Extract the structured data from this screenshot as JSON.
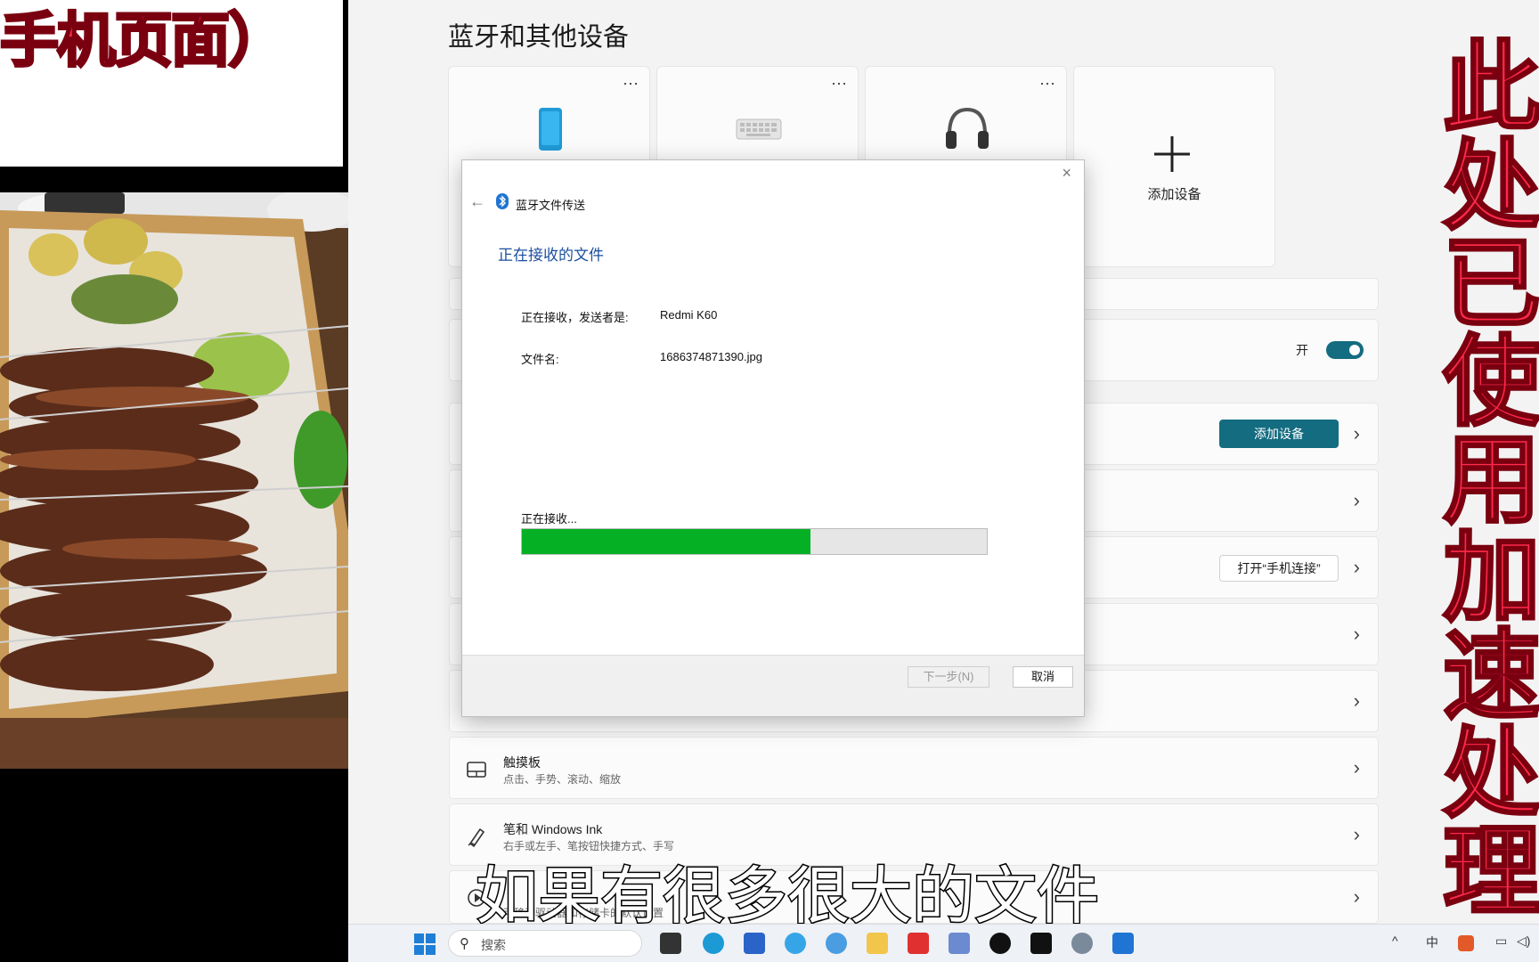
{
  "overlay": {
    "left_title": "手机页面）",
    "right_banner": "此处已使用加速处理",
    "subtitle": "如果有很多很大的文件"
  },
  "settings": {
    "page_title": "蓝牙和其他设备",
    "cards": [
      {
        "icon": "phone-icon",
        "more": "···"
      },
      {
        "icon": "keyboard-icon",
        "more": "···"
      },
      {
        "icon": "headphones-icon",
        "more": "···"
      }
    ],
    "add_card": {
      "icon": "plus-icon",
      "label": "添加设备"
    },
    "bluetooth_toggle": {
      "label": "开",
      "on": true
    },
    "add_device_button": "添加设备",
    "phone_link_button": "打开“手机连接”",
    "touchpad": {
      "title": "触摸板",
      "subtitle": "点击、手势、滚动、缩放"
    },
    "pen": {
      "title": "笔和 Windows Ink",
      "subtitle": "右手或左手、笔按钮快捷方式、手写"
    },
    "autoplay": {
      "subtitle": "可移动驱动器和存储卡的默认设置"
    }
  },
  "dialog": {
    "title": "蓝牙文件传送",
    "heading": "正在接收的文件",
    "sender_label": "正在接收，发送者是:",
    "sender_value": "Redmi K60",
    "file_label": "文件名:",
    "file_value": "1686374871390.jpg",
    "progress_label": "正在接收...",
    "progress_fraction": 0.62,
    "next_button": "下一步(N)",
    "cancel_button": "取消"
  },
  "taskbar": {
    "search_placeholder": "搜索",
    "tray_ime": "中"
  },
  "colors": {
    "accent": "#146c80",
    "progress": "#06b025",
    "overlay_red": "#ff2a4a",
    "dialog_heading": "#1b4f9e"
  }
}
